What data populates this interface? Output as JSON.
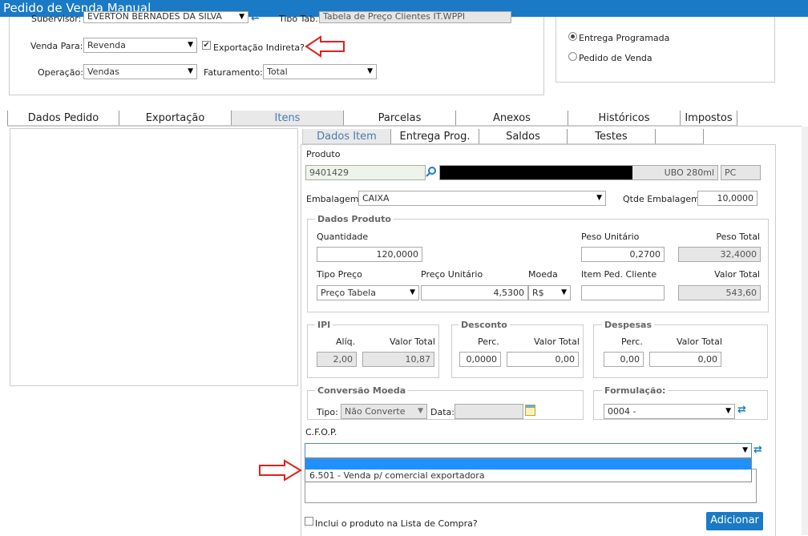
{
  "window": {
    "title": "Pedido de Venda Manual"
  },
  "header": {
    "supervisor_label": "Supervisor:",
    "supervisor_value": "EVERTON BERNADES DA SILVA",
    "tipo_tab_label": "Tipo Tab.:",
    "tipo_tab_value": "Tabela de Preço Clientes IT.WPPI",
    "venda_para_label": "Venda Para:",
    "venda_para_value": "Revenda",
    "exportacao_indireta_label": "Exportação Indireta?",
    "exportacao_indireta_checked": true,
    "operacao_label": "Operação:",
    "operacao_value": "Vendas",
    "faturamento_label": "Faturamento:",
    "faturamento_value": "Total",
    "entrega_programada_label": "Entrega Programada",
    "pedido_venda_label": "Pedido de Venda"
  },
  "main_tabs": [
    {
      "label": "Dados Pedido"
    },
    {
      "label": "Exportação"
    },
    {
      "label": "Itens",
      "active": true
    },
    {
      "label": "Parcelas"
    },
    {
      "label": "Anexos"
    },
    {
      "label": "Históricos"
    },
    {
      "label": "Impostos"
    }
  ],
  "sub_tabs": [
    {
      "label": "Dados Item",
      "active": true
    },
    {
      "label": "Entrega Prog."
    },
    {
      "label": "Saldos"
    },
    {
      "label": "Testes"
    }
  ],
  "item": {
    "produto_label": "Produto",
    "produto_code": "9401429",
    "produto_desc_suffix": "UBO 280ml",
    "unidade": "PC",
    "embalagem_label": "Embalagem",
    "embalagem_value": "CAIXA",
    "qtde_embalagem_label": "Qtde Embalagem",
    "qtde_embalagem_value": "10,0000"
  },
  "dados_produto": {
    "legend": "Dados Produto",
    "quantidade_label": "Quantidade",
    "quantidade_value": "120,0000",
    "peso_unitario_label": "Peso Unitário",
    "peso_unitario_value": "0,2700",
    "peso_total_label": "Peso Total",
    "peso_total_value": "32,4000",
    "tipo_preco_label": "Tipo Preço",
    "tipo_preco_value": "Preço Tabela",
    "preco_unitario_label": "Preço Unitário",
    "preco_unitario_value": "4,5300",
    "moeda_label": "Moeda",
    "moeda_value": "R$",
    "item_ped_cliente_label": "Item Ped. Cliente",
    "item_ped_cliente_value": "",
    "valor_total_label": "Valor Total",
    "valor_total_value": "543,60"
  },
  "ipi": {
    "legend": "IPI",
    "aliq_label": "Alíq.",
    "aliq_value": "2,00",
    "valor_total_label": "Valor Total",
    "valor_total_value": "10,87"
  },
  "desconto": {
    "legend": "Desconto",
    "perc_label": "Perc.",
    "perc_value": "0,0000",
    "valor_total_label": "Valor Total",
    "valor_total_value": "0,00"
  },
  "despesas": {
    "legend": "Despesas",
    "perc_label": "Perc.",
    "perc_value": "0,00",
    "valor_total_label": "Valor Total",
    "valor_total_value": "0,00"
  },
  "conversao_moeda": {
    "legend": "Conversão Moeda",
    "tipo_label": "Tipo:",
    "tipo_value": "Não Converte",
    "data_label": "Data:",
    "data_value": ""
  },
  "formulacao": {
    "legend": "Formulação:",
    "value": "0004 -"
  },
  "cfop": {
    "label": "C.F.O.P.",
    "value": "",
    "options": [
      {
        "label": ""
      },
      {
        "label": "6.501 - Venda p/ comercial exportadora"
      }
    ]
  },
  "footer": {
    "lista_compra_label": "Inclui o produto na Lista de Compra?",
    "adicionar_label": "Adicionar"
  },
  "colors": {
    "titlebar": "#1a7ac5",
    "accent": "#1a7ac5",
    "highlight": "#1e90ff",
    "annotation_arrow": "#e0201a"
  },
  "icons": [
    "search-icon",
    "refresh-icon",
    "calendar-icon",
    "dropdown-arrow-icon"
  ]
}
